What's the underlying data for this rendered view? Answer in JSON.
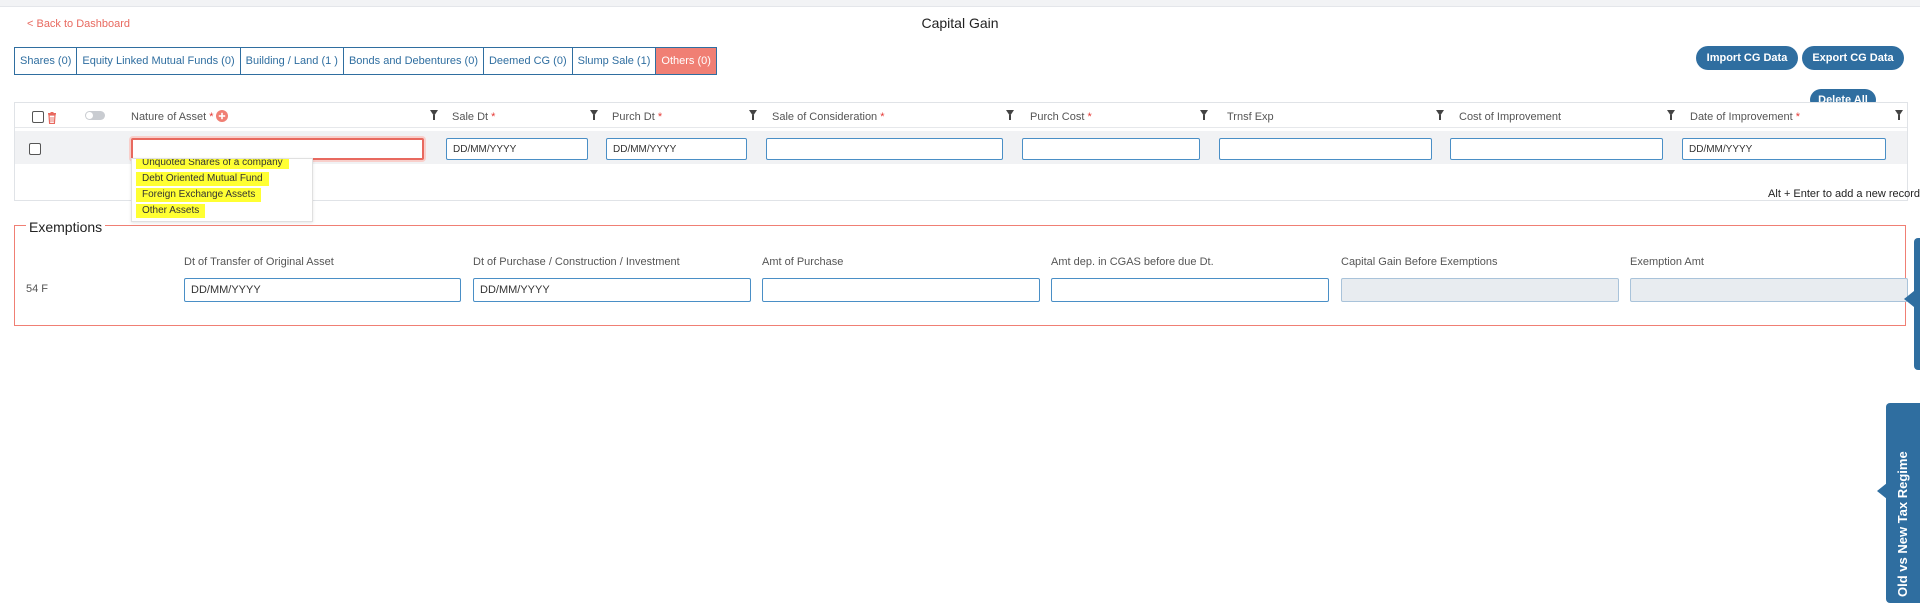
{
  "header": {
    "back_label": "< Back to Dashboard",
    "title": "Capital Gain"
  },
  "tabs": [
    {
      "label": "Shares (0)"
    },
    {
      "label": "Equity Linked Mutual Funds (0)"
    },
    {
      "label": "Building / Land (1 )"
    },
    {
      "label": "Bonds and Debentures (0)"
    },
    {
      "label": "Deemed CG (0)"
    },
    {
      "label": "Slump Sale (1)"
    },
    {
      "label": "Others (0)"
    }
  ],
  "active_tab": "Others (0)",
  "actions": {
    "import_label": "Import CG Data",
    "export_label": "Export CG Data",
    "delete_all_label": "Delete All"
  },
  "grid": {
    "columns": {
      "nature": "Nature of Asset",
      "sale_dt": "Sale Dt",
      "purch_dt": "Purch Dt",
      "sale_consideration": "Sale of Consideration",
      "purch_cost": "Purch Cost",
      "trnsf_exp": "Trnsf Exp",
      "cost_improvement": "Cost of Improvement",
      "date_improvement": "Date of Improvement"
    },
    "required_mark": "*",
    "row": {
      "nature_value": "",
      "date_placeholder": "DD/MM/YYYY"
    },
    "nature_options": [
      "Unquoted Shares of a company",
      "Debt Oriented Mutual Fund",
      "Foreign Exchange Assets",
      "Other Assets"
    ],
    "hint": "Alt + Enter to add a new record"
  },
  "exemptions": {
    "title": "Exemptions",
    "columns": {
      "dt_transfer": "Dt of Transfer of Original Asset",
      "dt_purchase": "Dt of Purchase / Construction / Investment",
      "amt_purchase": "Amt of Purchase",
      "amt_cgas": "Amt dep. in CGAS before due Dt.",
      "cg_before": "Capital Gain Before Exemptions",
      "exemption_amt": "Exemption Amt"
    },
    "row_label": "54 F",
    "date_placeholder": "DD/MM/YYYY"
  },
  "side_panel": {
    "regime_label": "Old vs New Tax Regime"
  },
  "colors": {
    "primary": "#2f6ea0",
    "accent": "#f07f74",
    "highlight": "#ffff33",
    "required": "#e53935"
  }
}
